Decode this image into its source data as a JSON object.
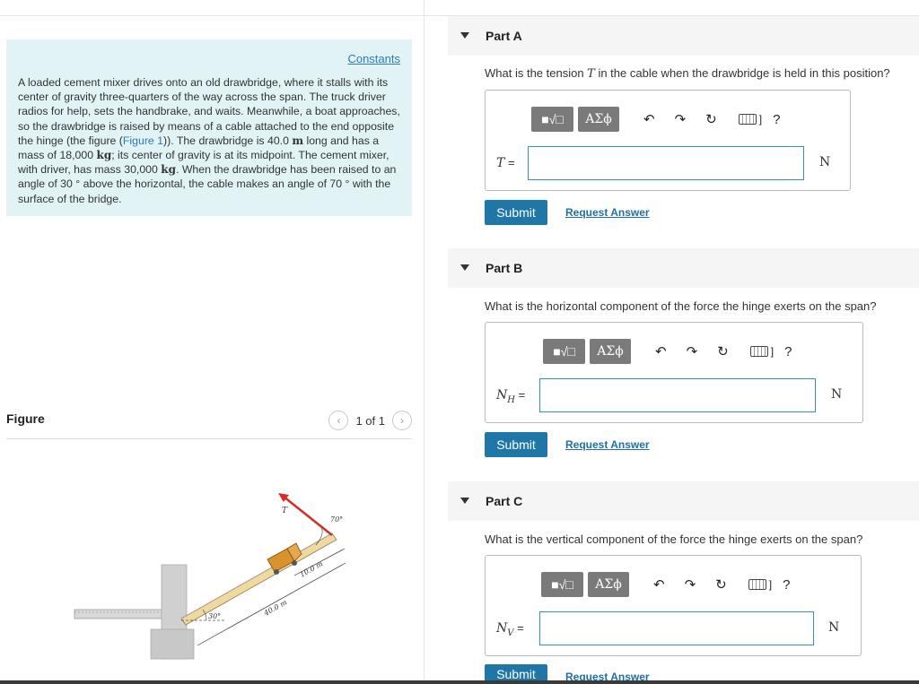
{
  "intro": {
    "constants_link": "Constants",
    "text_before_link": "A loaded cement mixer drives onto an old drawbridge, where it stalls with its center of gravity three-quarters of the way across the span. The truck driver radios for help, sets the handbrake, and waits. Meanwhile, a boat approaches, so the drawbridge is raised by means of a cable attached to the end opposite the hinge (the figure (",
    "figure_link": "Figure 1",
    "text_p2": ")). The drawbridge is 40.0 ",
    "unit_m": "m",
    "text_p3": " long and has a mass of 18,000 ",
    "unit_kg": "kg",
    "text_p4": "; its center of gravity is at its midpoint. The cement mixer, with driver, has mass 30,000 ",
    "unit_kg2": "kg",
    "text_p5": ". When the drawbridge has been raised to an angle of 30 ° above the horizontal, the cable makes an angle of 70 ° with the surface of the bridge."
  },
  "figure": {
    "label": "Figure",
    "pager_text": "1 of 1",
    "prev_icon": "‹",
    "next_icon": "›",
    "label_T": "T",
    "label_70": "70°",
    "label_10": "10.0 m",
    "label_40": "40.0 m",
    "label_30": "30°"
  },
  "toolbar": {
    "math_label": "■√□",
    "greek_label": "ΑΣϕ",
    "undo_icon": "↶",
    "redo_icon": "↷",
    "reset_icon": "↻",
    "kbd_bracket": "]",
    "help_icon": "?"
  },
  "parts": [
    {
      "title": "Part A",
      "question_pre": "What is the tension ",
      "question_var": "T",
      "question_post": " in the cable when the drawbridge is held in this position?",
      "var": "T",
      "var_sub": "",
      "equals": " =",
      "value": "",
      "unit": "N",
      "submit": "Submit",
      "request": "Request Answer"
    },
    {
      "title": "Part B",
      "question_pre": "What is the horizontal component of the force the hinge exerts on the span?",
      "question_var": "",
      "question_post": "",
      "var": "N",
      "var_sub": "H",
      "equals": " =",
      "value": "",
      "unit": "N",
      "submit": "Submit",
      "request": "Request Answer"
    },
    {
      "title": "Part C",
      "question_pre": "What is the vertical component of the force the hinge exerts on the span?",
      "question_var": "",
      "question_post": "",
      "var": "N",
      "var_sub": "V",
      "equals": " =",
      "value": "",
      "unit": "N",
      "submit": "Submit",
      "request": "Request Answer"
    }
  ]
}
